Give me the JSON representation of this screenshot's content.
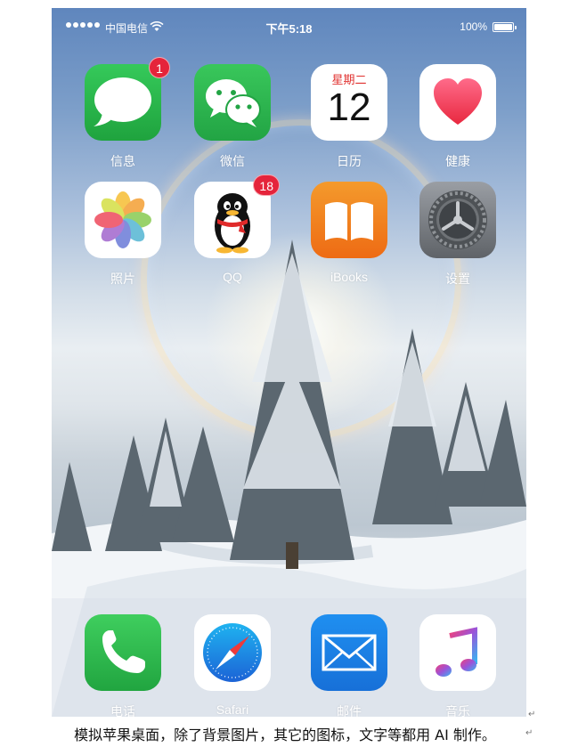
{
  "status_bar": {
    "carrier": "中国电信",
    "time": "下午5:18",
    "battery": "100%"
  },
  "home_apps": [
    {
      "label": "信息",
      "icon": "messages-icon",
      "badge": "1"
    },
    {
      "label": "微信",
      "icon": "wechat-icon"
    },
    {
      "label": "日历",
      "icon": "calendar-icon",
      "weekday": "星期二",
      "day": "12"
    },
    {
      "label": "健康",
      "icon": "health-heart-icon"
    },
    {
      "label": "照片",
      "icon": "photos-icon"
    },
    {
      "label": "QQ",
      "icon": "qq-penguin-icon",
      "badge": "18"
    },
    {
      "label": "iBooks",
      "icon": "ibooks-icon"
    },
    {
      "label": "设置",
      "icon": "settings-gear-icon"
    }
  ],
  "dock_apps": [
    {
      "label": "电话",
      "icon": "phone-icon"
    },
    {
      "label": "Safari",
      "icon": "safari-compass-icon"
    },
    {
      "label": "邮件",
      "icon": "mail-envelope-icon"
    },
    {
      "label": "音乐",
      "icon": "music-note-icon"
    }
  ],
  "caption": "模拟苹果桌面，除了背景图片，其它的图标，文字等都用 AI 制作。",
  "colors": {
    "badge": "#e5243b",
    "messages_green": "#2bb84a",
    "wechat_green": "#2dbb4c",
    "ibooks_orange": "#f0791b",
    "health_pink": "#f24a6b"
  }
}
